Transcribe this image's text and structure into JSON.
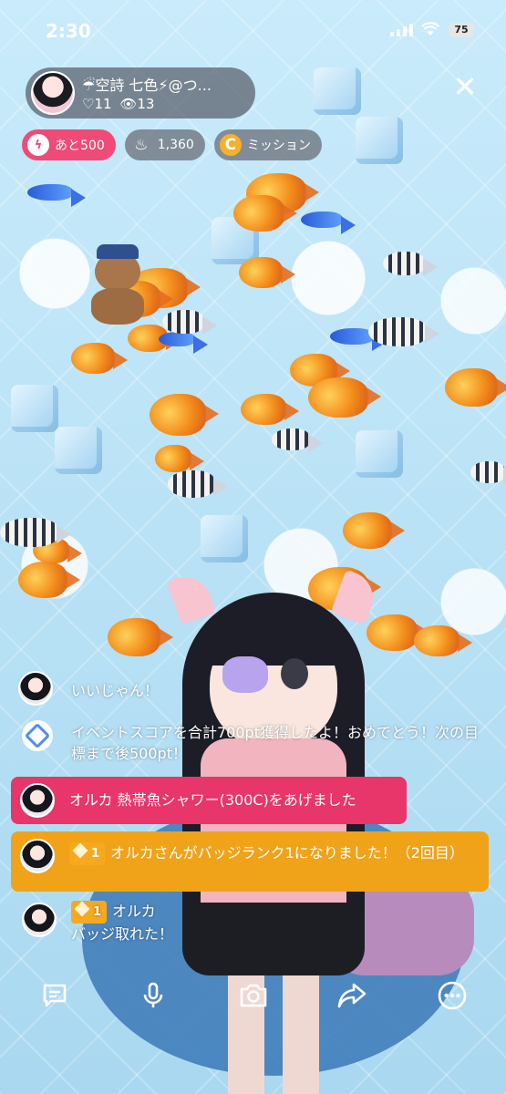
{
  "status_bar": {
    "time": "2:30",
    "battery": "75"
  },
  "streamer": {
    "name": "☔空詩 七色⚡@つ...",
    "hearts": "♡11",
    "viewers": "👁13"
  },
  "chips": [
    {
      "label": "あと500",
      "icon": "lightning-icon",
      "color": "#f04a77"
    },
    {
      "label": "1,360",
      "icon": "flame-icon"
    },
    {
      "label": "ミッション",
      "icon": "coin-icon",
      "icon_text": "C"
    }
  ],
  "chat": {
    "m1": {
      "text": "いいじゃん！"
    },
    "m2": {
      "text": "イベントスコアを合計700pt獲得したよ！おめでとう！次の目標まで後500pt！"
    },
    "m3": {
      "text": "オルカ 熱帯魚シャワー(300C)をあげました",
      "bg": "#e8356a"
    },
    "m4": {
      "badge": "1",
      "text": "オルカさんがバッジランク1になりました！（2回目）",
      "bg": "#f0a319"
    },
    "m5": {
      "badge": "1",
      "user": "オルカ",
      "text": "バッジ取れた！"
    }
  },
  "toolbar": [
    "comment-icon",
    "microphone-icon",
    "camera-icon",
    "share-icon",
    "more-icon"
  ],
  "colors": {
    "accent": "#f04a77",
    "orange": "#f0a319"
  }
}
